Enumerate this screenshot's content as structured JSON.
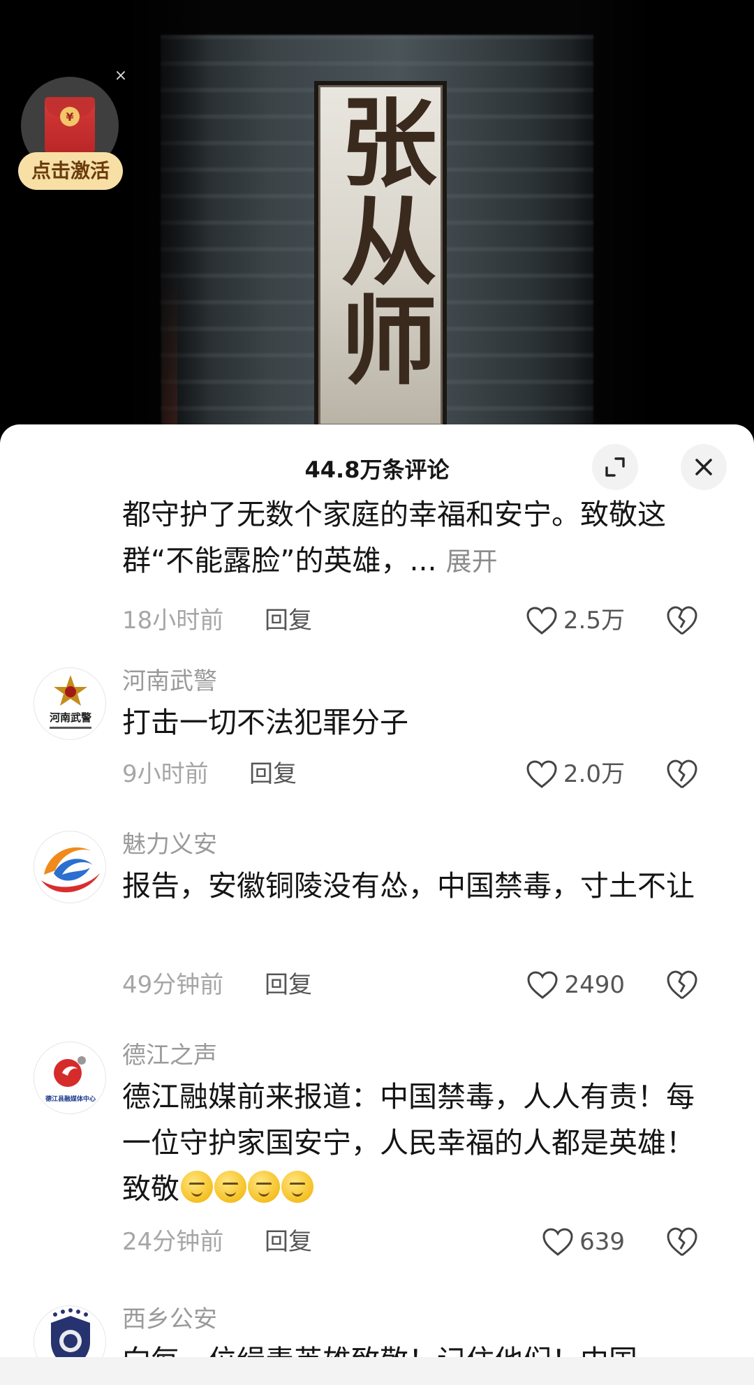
{
  "video": {
    "plaque_text": "张从师",
    "hongbao_close": "×",
    "activate_label": "点击激活",
    "coin_symbol": "¥"
  },
  "sheet": {
    "title": "44.8万条评论",
    "expand_icon": "expand-icon",
    "close_icon": "close-icon"
  },
  "comments": [
    {
      "text": "都守护了无数个家庭的幸福和安宁。致敬这群“不能露脸”的英雄，...",
      "expand_label": "展开",
      "time": "18小时前",
      "reply": "回复",
      "likes": "2.5万"
    },
    {
      "user": "河南武警",
      "avatar_text": "河南武警",
      "text": "打击一切不法犯罪分子",
      "time": "9小时前",
      "reply": "回复",
      "likes": "2.0万"
    },
    {
      "user": "魅力义安",
      "text": "报告，安徽铜陵没有怂，中国禁毒，寸土不让",
      "time": "49分钟前",
      "reply": "回复",
      "likes": "2490"
    },
    {
      "user": "德江之声",
      "avatar_text": "德江县融媒体中心",
      "text": "德江融媒前来报道：中国禁毒，人人有责！每一位守护家国安宁，人民幸福的人都是英雄！致敬",
      "time": "24分钟前",
      "reply": "回复",
      "likes": "639"
    },
    {
      "user": "西乡公安",
      "text": "向每一位缉毒英雄致敬！记住他们！中国"
    }
  ],
  "colors": {
    "accent_badge": "#f7dfa6",
    "text_primary": "#151515",
    "text_muted": "#9a9a9a"
  }
}
